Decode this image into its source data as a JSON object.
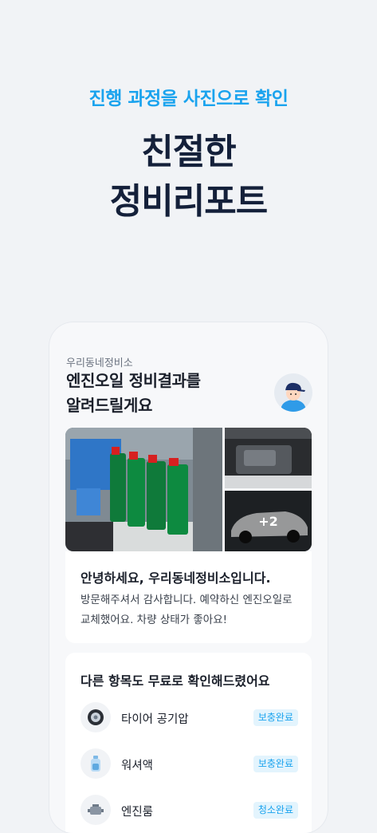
{
  "promo": {
    "subhead": "진행 과정을 사진으로 확인",
    "headline_line1": "친절한",
    "headline_line2": "정비리포트"
  },
  "report": {
    "shop_name": "우리동네정비소",
    "title_line1": "엔진오일 정비결과를",
    "title_line2": "알려드릴게요",
    "photos": {
      "more_count": "+2"
    },
    "message": {
      "title": "안녕하세요, 우리동네정비소입니다.",
      "body": "방문해주셔서 감사합니다. 예약하신 엔진오일로 교체했어요. 차량 상태가 좋아요!"
    },
    "checklist": {
      "title": "다른 항목도 무료로 확인해드렸어요",
      "items": [
        {
          "label": "타이어 공기압",
          "status": "보충완료",
          "icon": "tire-icon"
        },
        {
          "label": "워셔액",
          "status": "보충완료",
          "icon": "washer-fluid-icon"
        },
        {
          "label": "엔진룸",
          "status": "청소완료",
          "icon": "engine-icon"
        }
      ]
    }
  },
  "colors": {
    "accent": "#1aa3ee",
    "headline": "#14203a",
    "background": "#f1f3f6"
  }
}
